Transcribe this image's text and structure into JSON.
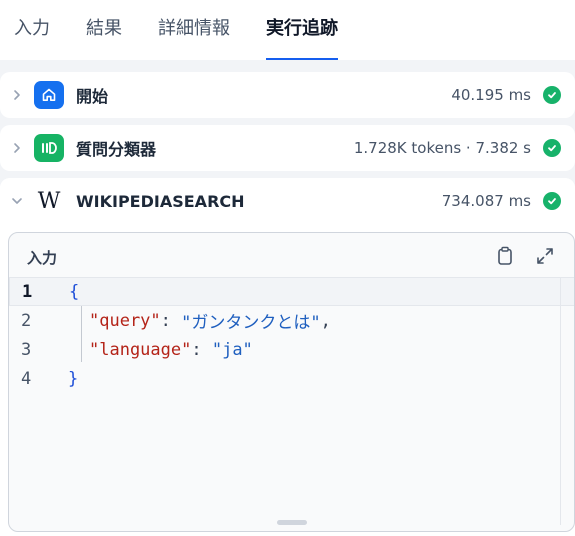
{
  "tabs": [
    "入力",
    "結果",
    "詳細情報",
    "実行追跡"
  ],
  "active_tab_index": 3,
  "trace": {
    "nodes": [
      {
        "title": "開始",
        "meta": "40.195 ms",
        "icon": "home-icon",
        "expanded": false,
        "status": "success"
      },
      {
        "title": "質問分類器",
        "meta": "1.728K tokens · 7.382 s",
        "icon": "question-classifier-icon",
        "expanded": false,
        "status": "success"
      },
      {
        "title": "WIKIPEDIASEARCH",
        "meta": "734.087 ms",
        "icon": "wikipedia-icon",
        "logo_text": "W",
        "expanded": true,
        "status": "success"
      }
    ]
  },
  "editor": {
    "label": "入力",
    "line_numbers": [
      "1",
      "2",
      "3",
      "4"
    ],
    "open_brace": "{",
    "close_brace": "}",
    "query_key": "\"query\"",
    "query_value": "\"ガンタンクとは\"",
    "language_key": "\"language\"",
    "language_value": "\"ja\"",
    "colon": ": ",
    "comma": ","
  },
  "colors": {
    "accent": "#155eef",
    "success": "#17b26a",
    "start_icon_bg": "#1570ef",
    "classifier_icon_bg": "#16b364"
  }
}
